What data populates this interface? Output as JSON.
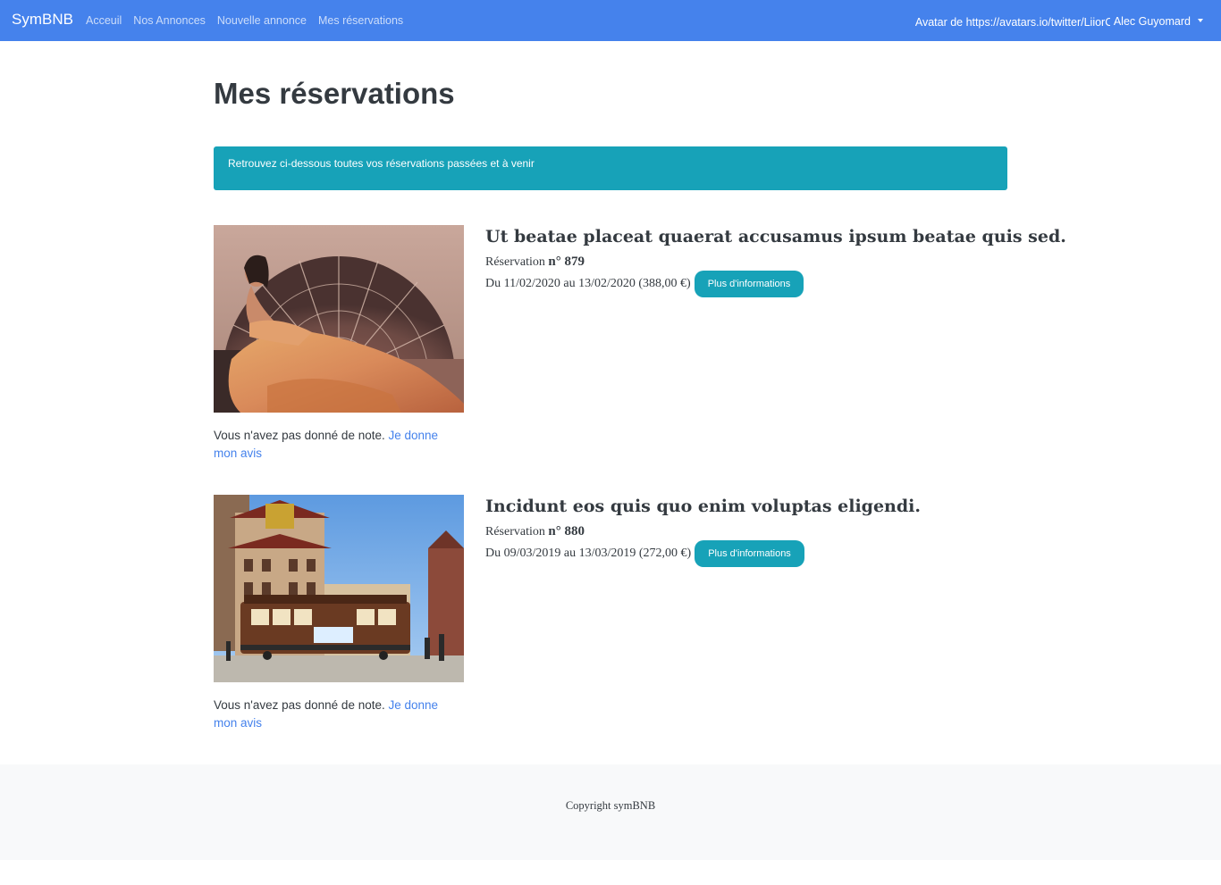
{
  "navbar": {
    "brand": "SymBNB",
    "links": [
      "Acceuil",
      "Nos Annonces",
      "Nouvelle annonce",
      "Mes réservations"
    ],
    "avatar_alt": "Avatar de https://avatars.io/twitter/LiiorC",
    "user_name": "Alec Guyomard"
  },
  "page": {
    "title": "Mes réservations",
    "alert": "Retrouvez ci-dessous toutes vos réservations passées et à venir"
  },
  "bookings": [
    {
      "title": "Ut beatae placeat quaerat accusamus ipsum beatae quis sed.",
      "ref_label": "Réservation ",
      "ref_number": "n° 879",
      "dates": "Du 11/02/2020 au 13/02/2020 (388,00 €)",
      "button": "Plus d'informations",
      "review_text": "Vous n'avez pas donné de note.",
      "review_link": "Je donne mon avis"
    },
    {
      "title": "Incidunt eos quis quo enim voluptas eligendi.",
      "ref_label": "Réservation ",
      "ref_number": "n° 880",
      "dates": "Du 09/03/2019 au 13/03/2019 (272,00 €)",
      "button": "Plus d'informations",
      "review_text": "Vous n'avez pas donné de note.",
      "review_link": "Je donne mon avis"
    }
  ],
  "footer": {
    "text": "Copyright symBNB"
  },
  "colors": {
    "navbar": "#4582ec",
    "info": "#17a2b8",
    "link": "#4582ec",
    "footer_bg": "#f8f9fa"
  }
}
